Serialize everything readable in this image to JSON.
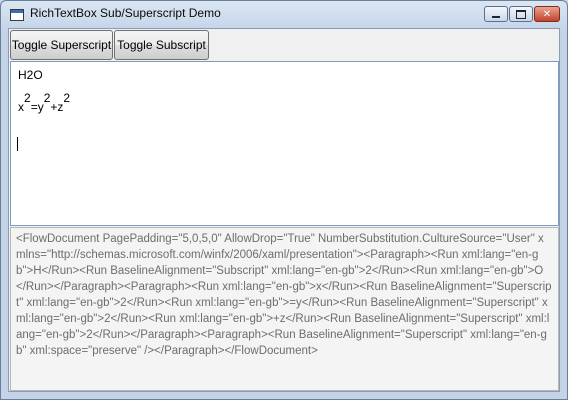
{
  "window": {
    "title": "RichTextBox Sub/Superscript Demo"
  },
  "toolbar": {
    "superscript_label": "Toggle Superscript",
    "subscript_label": "Toggle Subscript"
  },
  "editor": {
    "line1": {
      "h": "H",
      "sub": "2",
      "o": "O"
    },
    "line2": {
      "x": "x",
      "sup1": "2",
      "eq": "=y",
      "sup2": "2",
      "plus": "+z",
      "sup3": "2"
    }
  },
  "xml_output": "<FlowDocument PagePadding=\"5,0,5,0\" AllowDrop=\"True\" NumberSubstitution.CultureSource=\"User\" xmlns=\"http://schemas.microsoft.com/winfx/2006/xaml/presentation\"><Paragraph><Run xml:lang=\"en-gb\">H</Run><Run BaselineAlignment=\"Subscript\" xml:lang=\"en-gb\">2</Run><Run xml:lang=\"en-gb\">O</Run></Paragraph><Paragraph><Run xml:lang=\"en-gb\">x</Run><Run BaselineAlignment=\"Superscript\" xml:lang=\"en-gb\">2</Run><Run xml:lang=\"en-gb\">=y</Run><Run BaselineAlignment=\"Superscript\" xml:lang=\"en-gb\">2</Run><Run xml:lang=\"en-gb\">+z</Run><Run BaselineAlignment=\"Superscript\" xml:lang=\"en-gb\">2</Run></Paragraph><Paragraph><Run BaselineAlignment=\"Superscript\" xml:lang=\"en-gb\" xml:space=\"preserve\" /></Paragraph></FlowDocument>"
}
